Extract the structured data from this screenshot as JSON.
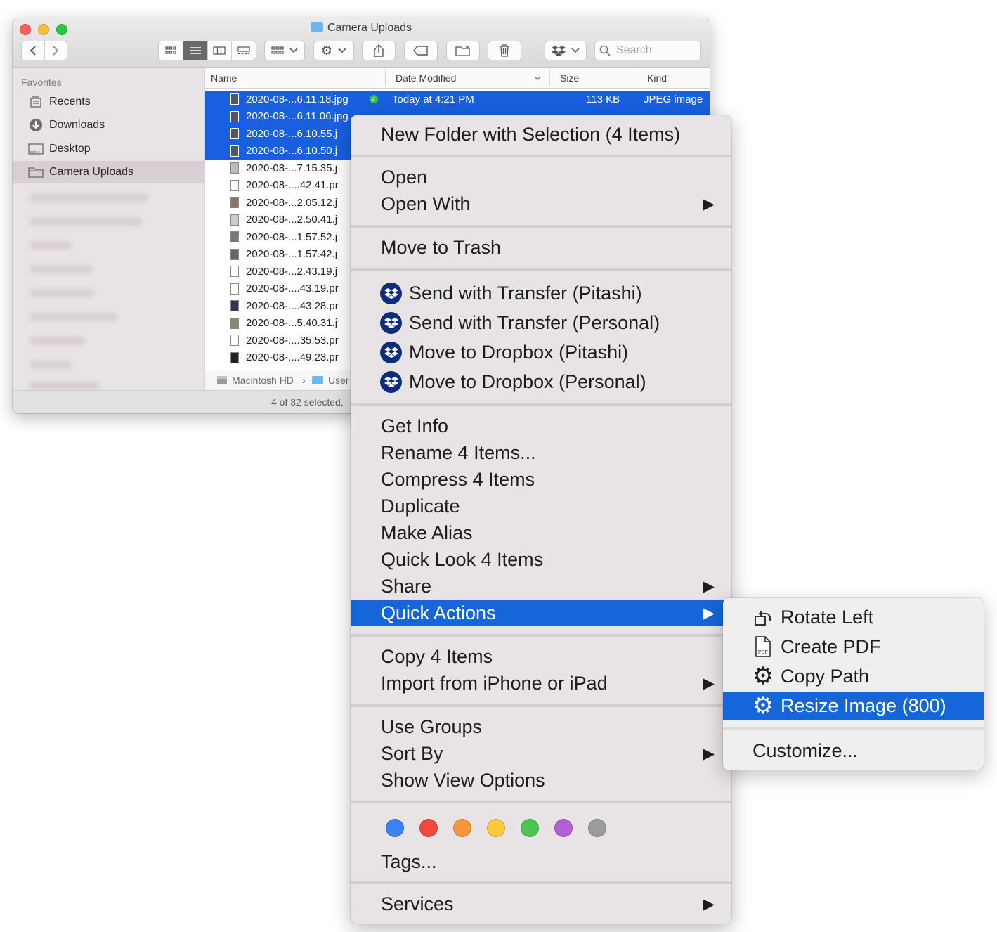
{
  "window": {
    "title": "Camera Uploads",
    "search_placeholder": "Search"
  },
  "sidebar": {
    "section": "Favorites",
    "items": [
      {
        "label": "Recents",
        "icon": "recents-icon"
      },
      {
        "label": "Downloads",
        "icon": "downloads-icon"
      },
      {
        "label": "Desktop",
        "icon": "desktop-icon"
      },
      {
        "label": "Camera Uploads",
        "icon": "folder-icon",
        "active": true
      }
    ]
  },
  "columns": {
    "name": "Name",
    "date": "Date Modified",
    "size": "Size",
    "kind": "Kind"
  },
  "files": [
    {
      "name": "2020-08-...6.11.18.jpg",
      "date": "Today at 4:21 PM",
      "size": "113 KB",
      "kind": "JPEG image",
      "selected": true
    },
    {
      "name": "2020-08-...6.11.06.jpg",
      "date": "",
      "size": "",
      "kind": "",
      "selected": true
    },
    {
      "name": "2020-08-...6.10.55.j",
      "date": "",
      "size": "",
      "kind": "",
      "selected": true
    },
    {
      "name": "2020-08-...6.10.50.j",
      "date": "",
      "size": "",
      "kind": "",
      "selected": true
    },
    {
      "name": "2020-08-...7.15.35.j",
      "selected": false
    },
    {
      "name": "2020-08-....42.41.pr",
      "selected": false
    },
    {
      "name": "2020-08-...2.05.12.j",
      "selected": false
    },
    {
      "name": "2020-08-...2.50.41.j",
      "selected": false
    },
    {
      "name": "2020-08-...1.57.52.j",
      "selected": false
    },
    {
      "name": "2020-08-...1.57.42.j",
      "selected": false
    },
    {
      "name": "2020-08-...2.43.19.j",
      "selected": false
    },
    {
      "name": "2020-08-....43.19.pr",
      "selected": false
    },
    {
      "name": "2020-08-....43.28.pr",
      "selected": false
    },
    {
      "name": "2020-08-...5.40.31.j",
      "selected": false
    },
    {
      "name": "2020-08-....35.53.pr",
      "selected": false
    },
    {
      "name": "2020-08-....49.23.pr",
      "selected": false
    }
  ],
  "pathbar": {
    "disk": "Macintosh HD",
    "sep": "›",
    "folder": "User"
  },
  "status": "4 of 32 selected,",
  "context_menu": {
    "new_folder": "New Folder with Selection (4 Items)",
    "open": "Open",
    "open_with": "Open With",
    "move_to_trash": "Move to Trash",
    "send_transfer_pitashi": "Send with Transfer (Pitashi)",
    "send_transfer_personal": "Send with Transfer (Personal)",
    "move_dropbox_pitashi": "Move to Dropbox (Pitashi)",
    "move_dropbox_personal": "Move to Dropbox (Personal)",
    "get_info": "Get Info",
    "rename": "Rename 4 Items...",
    "compress": "Compress 4 Items",
    "duplicate": "Duplicate",
    "make_alias": "Make Alias",
    "quick_look": "Quick Look 4 Items",
    "share": "Share",
    "quick_actions": "Quick Actions",
    "copy": "Copy 4 Items",
    "import_iphone": "Import from iPhone or iPad",
    "use_groups": "Use Groups",
    "sort_by": "Sort By",
    "show_view_options": "Show View Options",
    "tags": "Tags...",
    "services": "Services",
    "tag_colors": [
      "#3b82f6",
      "#f0483e",
      "#f7963a",
      "#fcc93a",
      "#4cc552",
      "#b260d6",
      "#9b9a9c"
    ],
    "submenu_arrow": "▶"
  },
  "quick_actions_submenu": {
    "rotate_left": "Rotate Left",
    "create_pdf": "Create PDF",
    "copy_path": "Copy Path",
    "resize_image": "Resize Image (800)",
    "customize": "Customize..."
  }
}
